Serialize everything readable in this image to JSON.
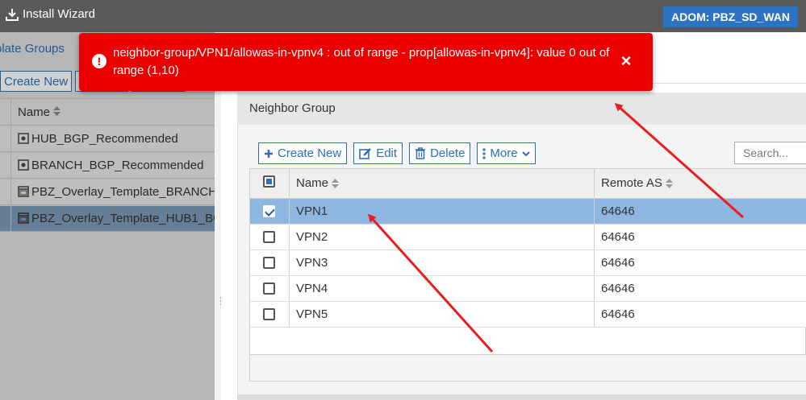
{
  "topbar": {
    "install_wizard": "Install Wizard",
    "adom": "ADOM: PBZ_SD_WAN"
  },
  "left_panel": {
    "tab": "plate Groups",
    "create_new": "Create New",
    "name_header": "Name",
    "rows": [
      {
        "label": "HUB_BGP_Recommended"
      },
      {
        "label": "BRANCH_BGP_Recommended"
      },
      {
        "label": "PBZ_Overlay_Template_BRANCH_"
      },
      {
        "label": "PBZ_Overlay_Template_HUB1_BG"
      }
    ]
  },
  "neighbor_group": {
    "title": "Neighbor Group",
    "toolbar": {
      "create_new": "Create New",
      "edit": "Edit",
      "delete": "Delete",
      "more": "More"
    },
    "search_placeholder": "Search...",
    "columns": {
      "name": "Name",
      "remote_as": "Remote AS"
    },
    "rows": [
      {
        "name": "VPN1",
        "remote_as": "64646",
        "checked": true
      },
      {
        "name": "VPN2",
        "remote_as": "64646",
        "checked": false
      },
      {
        "name": "VPN3",
        "remote_as": "64646",
        "checked": false
      },
      {
        "name": "VPN4",
        "remote_as": "64646",
        "checked": false
      },
      {
        "name": "VPN5",
        "remote_as": "64646",
        "checked": false
      }
    ]
  },
  "error_toast": {
    "message": "neighbor-group/VPN1/allowas-in-vpnv4 : out of range - prop[allowas-in-vpnv4]: value 0 out of range (1,10)",
    "close": "×",
    "color": "#eb0000"
  },
  "colors": {
    "selected_row": "#8db6e0",
    "accent": "#2e6fb3",
    "adom_badge": "#2b74c4",
    "annotation_arrow": "#e61e1e"
  }
}
